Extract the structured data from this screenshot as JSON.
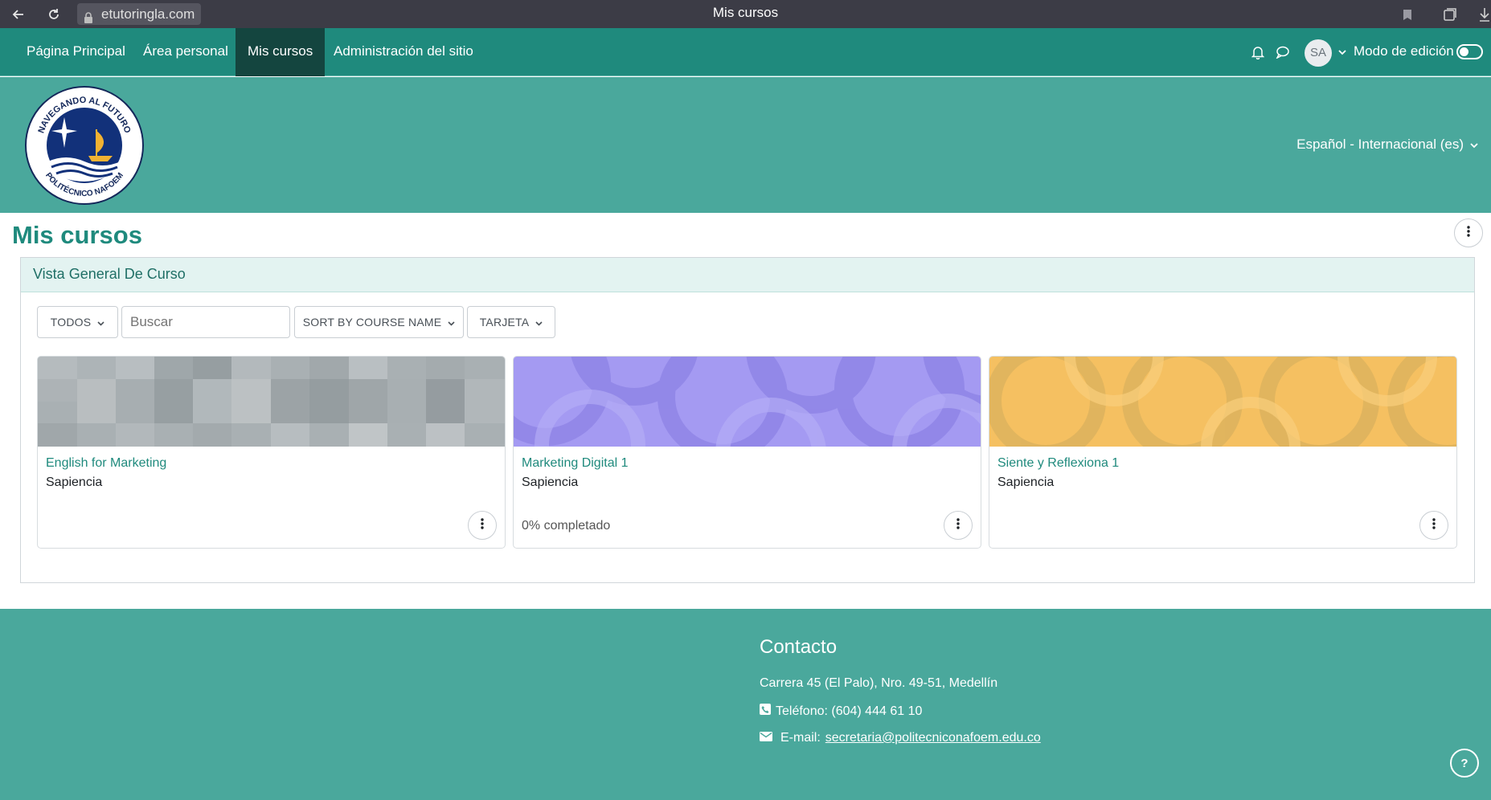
{
  "browser": {
    "url": "etutoringla.com",
    "window_title": "Mis cursos"
  },
  "navbar": {
    "items": [
      {
        "label": "Página Principal"
      },
      {
        "label": "Área personal"
      },
      {
        "label": "Mis cursos",
        "active": true
      },
      {
        "label": "Administración del sitio"
      }
    ],
    "avatar_initials": "SA",
    "edit_mode_label": "Modo de edición",
    "edit_mode_on": false
  },
  "header": {
    "language": "Español - Internacional (es)",
    "logo_text_top": "NAVEGANDO AL FUTURO",
    "logo_text_bottom": "POLITÉCNICO NAFOEM"
  },
  "page": {
    "title": "Mis cursos"
  },
  "course_overview": {
    "heading": "Vista General De Curso",
    "filter_label": "TODOS",
    "search_placeholder": "Buscar",
    "sort_label": "SORT BY COURSE NAME",
    "view_label": "TARJETA",
    "courses": [
      {
        "name": "English for Marketing",
        "category": "Sapiencia",
        "progress_text": ""
      },
      {
        "name": "Marketing Digital 1",
        "category": "Sapiencia",
        "progress_text": "0% completado"
      },
      {
        "name": "Siente y Reflexiona 1",
        "category": "Sapiencia",
        "progress_text": ""
      }
    ]
  },
  "footer": {
    "heading": "Contacto",
    "address": "Carrera 45 (El Palo), Nro. 49-51, Medellín",
    "phone": "Teléfono: (604) 444 61 10",
    "email_label": "E-mail:",
    "email": "secretaria@politecniconafoem.edu.co"
  },
  "colors": {
    "primary": "#1f8a7d",
    "header_bg": "#4aa89c",
    "active_nav": "#14453f"
  }
}
